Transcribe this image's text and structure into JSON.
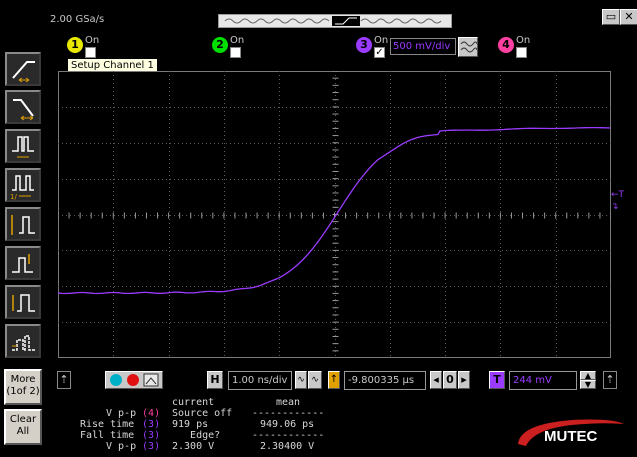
{
  "header": {
    "sample_rate": "2.00 GSa/s",
    "maximize_label": "▭",
    "close_label": "✕"
  },
  "toolbar": {
    "buttons": [
      "rising-edge-trigger",
      "falling-edge-trigger",
      "pulse-width",
      "pulse-width-2",
      "pattern-trigger",
      "glitch-trigger",
      "state-trigger",
      "timeout-trigger"
    ],
    "more_label": "More",
    "more_sub_label": "(1of 2)",
    "clear_label": "Clear",
    "clear_sub_label": "All"
  },
  "channels": [
    {
      "num": "1",
      "on_label": "On",
      "checked": "",
      "color": "#e8e800"
    },
    {
      "num": "2",
      "on_label": "On",
      "checked": "",
      "color": "#00e000"
    },
    {
      "num": "3",
      "on_label": "On",
      "checked": "✓",
      "color": "#9b3bff",
      "scale": "500 mV/div"
    },
    {
      "num": "4",
      "on_label": "On",
      "checked": "",
      "color": "#ff40a0"
    }
  ],
  "tooltip": "Setup Channel 1",
  "scope": {
    "trace_color": "#9b3bff",
    "trigger_marker": "←T",
    "trigger_level_marker": "↴"
  },
  "controls": {
    "timebase_label": "H",
    "timebase_value": "1.00 ns/div",
    "delay_value": "-9.800335 µs",
    "delay_zero": "0",
    "trigger_label": "T",
    "trigger_level": "244 mV"
  },
  "measurements": {
    "col_current": "current",
    "col_mean": "mean",
    "rows": [
      {
        "name": "V p-p",
        "ch": "4",
        "current": "Source off",
        "mean": "------------"
      },
      {
        "name": "Rise time",
        "ch": "3",
        "current": "919 ps",
        "mean": "949.06 ps"
      },
      {
        "name": "Fall time",
        "ch": "3",
        "current": "   Edge?",
        "mean": "------------"
      },
      {
        "name": "V p-p",
        "ch": "3",
        "current": "2.300 V",
        "mean": "2.30400 V"
      }
    ]
  },
  "logo": {
    "text": "MUTEC",
    "accent": "#cc1f1f"
  }
}
